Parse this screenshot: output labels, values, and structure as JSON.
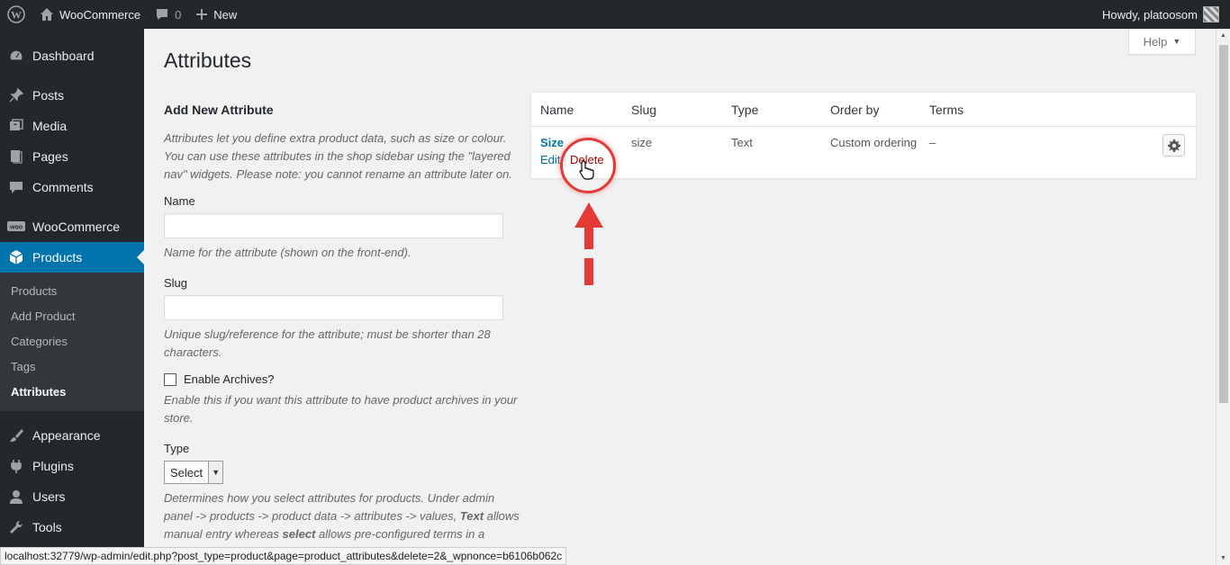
{
  "admin_bar": {
    "site_name": "WooCommerce",
    "comments_count": "0",
    "new_label": "New",
    "greeting": "Howdy, platoosom"
  },
  "sidebar": {
    "items": [
      {
        "label": "Dashboard",
        "icon": "dashboard-icon"
      },
      {
        "label": "Posts",
        "icon": "pin-icon"
      },
      {
        "label": "Media",
        "icon": "media-icon"
      },
      {
        "label": "Pages",
        "icon": "pages-icon"
      },
      {
        "label": "Comments",
        "icon": "comment-icon"
      },
      {
        "label": "WooCommerce",
        "icon": "woo-icon"
      },
      {
        "label": "Products",
        "icon": "box-icon"
      },
      {
        "label": "Appearance",
        "icon": "brush-icon"
      },
      {
        "label": "Plugins",
        "icon": "plug-icon"
      },
      {
        "label": "Users",
        "icon": "user-icon"
      },
      {
        "label": "Tools",
        "icon": "wrench-icon"
      }
    ],
    "submenu": [
      "Products",
      "Add Product",
      "Categories",
      "Tags",
      "Attributes"
    ],
    "current_item": "Products",
    "current_sub": "Attributes"
  },
  "page": {
    "title": "Attributes",
    "help_label": "Help"
  },
  "form": {
    "heading": "Add New Attribute",
    "intro": "Attributes let you define extra product data, such as size or colour. You can use these attributes in the shop sidebar using the \"layered nav\" widgets. Please note: you cannot rename an attribute later on.",
    "name_label": "Name",
    "name_value": "",
    "name_desc": "Name for the attribute (shown on the front-end).",
    "slug_label": "Slug",
    "slug_value": "",
    "slug_desc": "Unique slug/reference for the attribute; must be shorter than 28 characters.",
    "archives_label": "Enable Archives?",
    "archives_checked": false,
    "archives_desc": "Enable this if you want this attribute to have product archives in your store.",
    "type_label": "Type",
    "type_value": "Select",
    "type_desc_1": "Determines how you select attributes for products. Under admin panel -> products -> product data -> attributes -> values, ",
    "type_desc_text": "Text",
    "type_desc_2": " allows manual entry whereas ",
    "type_desc_select": "select",
    "type_desc_3": " allows pre-configured terms in a dropdown list."
  },
  "table": {
    "columns": [
      "Name",
      "Slug",
      "Type",
      "Order by",
      "Terms"
    ],
    "rows": [
      {
        "name": "Size",
        "slug": "size",
        "type": "Text",
        "order_by": "Custom ordering",
        "terms": "–",
        "edit_label": "Edit",
        "delete_label": "Delete"
      }
    ]
  },
  "statusbar": {
    "url": "localhost:32779/wp-admin/edit.php?post_type=product&page=product_attributes&delete=2&_wpnonce=b6106b062c"
  },
  "colors": {
    "admin_bar_bg": "#23282d",
    "accent": "#0073aa",
    "delete": "#aa0000",
    "annotation": "#e53935"
  }
}
